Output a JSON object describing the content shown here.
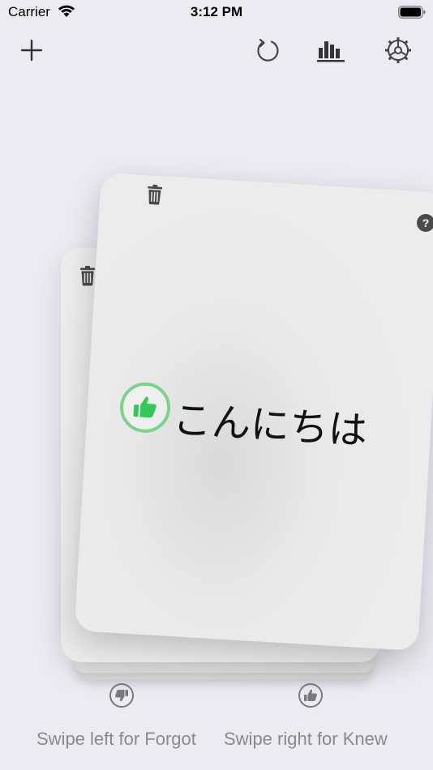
{
  "status_bar": {
    "carrier": "Carrier",
    "time": "3:12 PM"
  },
  "toolbar": {
    "add_icon": "plus-icon",
    "undo_icon": "undo-icon",
    "stats_icon": "bar-chart-icon",
    "settings_icon": "gear-icon"
  },
  "card": {
    "word": "こんにちは",
    "help_label": "?",
    "status_icon": "thumbs-up-icon",
    "status_color": "#34c759"
  },
  "hints": {
    "left_text": "Swipe left for Forgot",
    "right_text": "Swipe right for Knew",
    "left_icon": "thumbs-down-icon",
    "right_icon": "thumbs-up-icon"
  },
  "colors": {
    "background": "#ebebf1",
    "card": "#ececec",
    "accent_green": "#7fd18e",
    "icon_gray": "#4a4a4a",
    "hint_gray": "#8a8a8e"
  }
}
